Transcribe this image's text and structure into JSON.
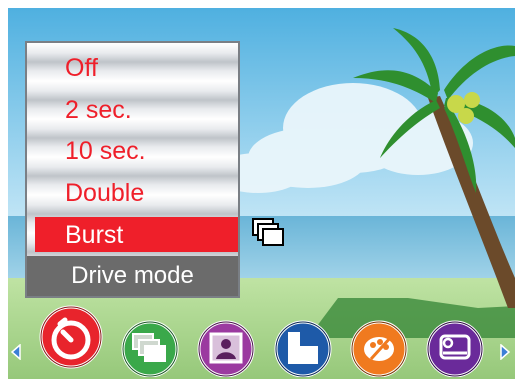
{
  "drive_menu": {
    "items": [
      {
        "label": "Off"
      },
      {
        "label": "2 sec."
      },
      {
        "label": "10 sec."
      },
      {
        "label": "Double"
      },
      {
        "label": "Burst",
        "selected": true
      }
    ],
    "title": "Drive mode"
  },
  "current_mode_icon": "burst-icon",
  "carousel": {
    "icons": [
      {
        "name": "self-timer-icon",
        "color": "#e8242c",
        "selected": true
      },
      {
        "name": "burst-icon",
        "color": "#3aa84a"
      },
      {
        "name": "portrait-scene-icon",
        "color": "#9b3aa0"
      },
      {
        "name": "image-size-icon",
        "color": "#1e5aa8"
      },
      {
        "name": "color-effect-icon",
        "color": "#f07a1f"
      },
      {
        "name": "settings-icon",
        "color": "#6a2a9a"
      }
    ]
  },
  "colors": {
    "accent": "#ef1f2a",
    "menu_title_bg": "#6b6b6b"
  }
}
